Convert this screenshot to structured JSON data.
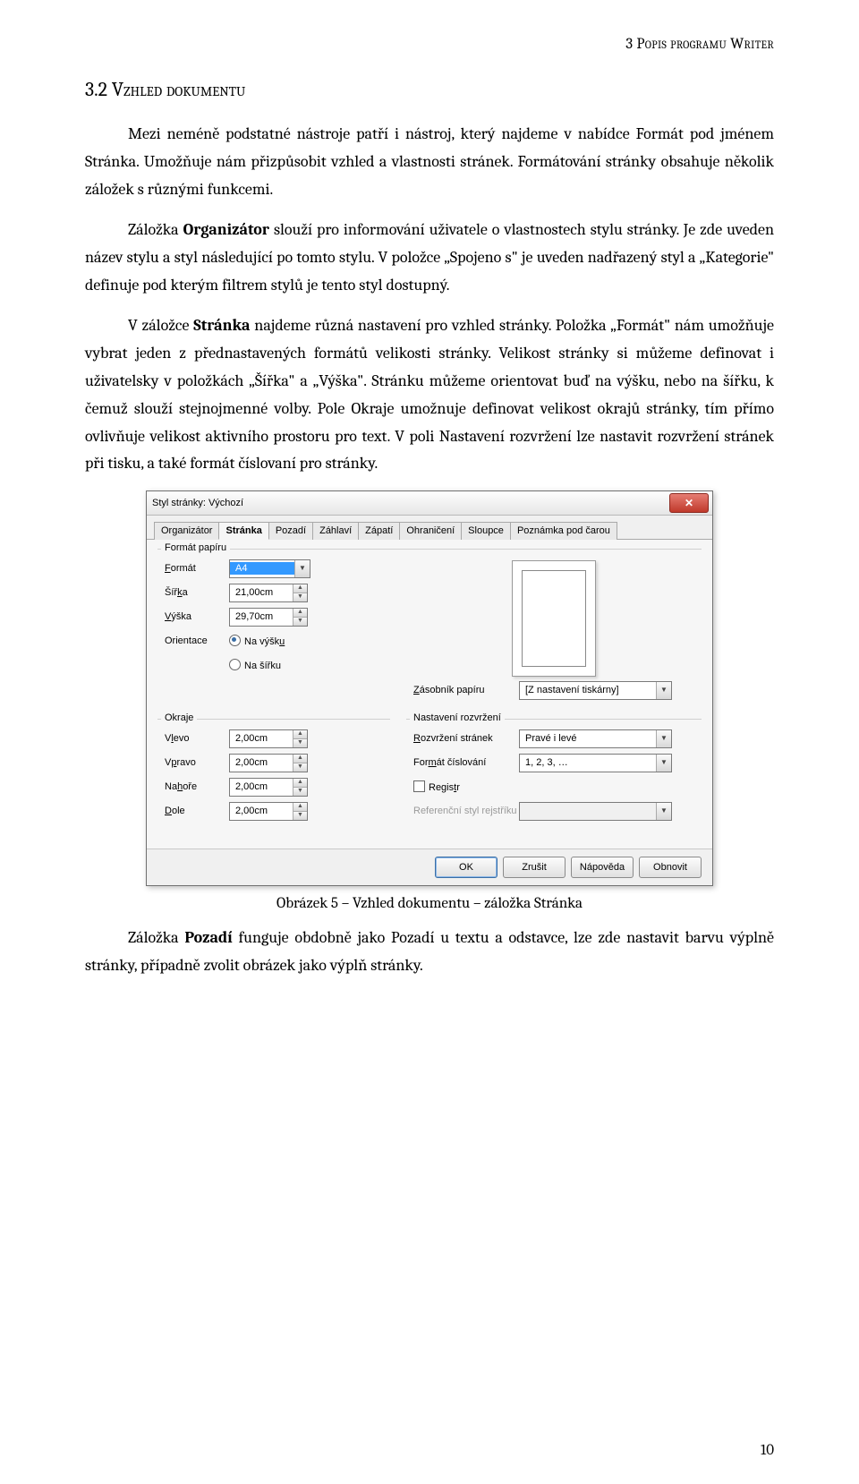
{
  "header": {
    "running": "3 Popis programu Writer"
  },
  "section": {
    "heading": "3.2  Vzhled dokumentu"
  },
  "paragraphs": {
    "p1": "Mezi neméně podstatné nástroje patří i nástroj, který najdeme v nabídce Formát pod jménem Stránka. Umožňuje nám přizpůsobit vzhled a vlastnosti stránek. Formátování stránky obsahuje několik záložek s různými funkcemi.",
    "p2a": "Záložka ",
    "p2b": "Organizátor",
    "p2c": " slouží pro informování uživatele o vlastnostech stylu stránky. Je zde uveden název stylu a styl následující po tomto stylu. V položce „Spojeno s\" je uveden nadřazený styl a „Kategorie\" definuje pod kterým filtrem stylů je tento styl dostupný.",
    "p3a": "V záložce ",
    "p3b": "Stránka",
    "p3c": " najdeme různá nastavení pro vzhled stránky. Položka „Formát\" nám umožňuje vybrat jeden z přednastavených formátů velikosti stránky. Velikost stránky si můžeme definovat i uživatelsky v položkách „Šířka\" a „Výška\". Stránku můžeme orientovat buď na výšku, nebo na šířku, k čemuž slouží stejnojmenné volby. Pole Okraje umožnuje definovat velikost okrajů stránky, tím přímo ovlivňuje velikost aktivního prostoru pro text. V poli Nastavení rozvržení lze nastavit rozvržení stránek při tisku, a také formát číslovaní pro stránky.",
    "p4a": "Záložka ",
    "p4b": "Pozadí",
    "p4c": " funguje obdobně jako Pozadí u textu a odstavce, lze zde nastavit barvu výplně stránky, případně zvolit obrázek jako výplň stránky."
  },
  "figure": {
    "caption": "Obrázek 5 – Vzhled dokumentu – záložka Stránka"
  },
  "page": {
    "number": "10"
  },
  "dialog": {
    "title": "Styl stránky: Výchozí",
    "tabs": [
      "Organizátor",
      "Stránka",
      "Pozadí",
      "Záhlaví",
      "Zápatí",
      "Ohraničení",
      "Sloupce",
      "Poznámka pod čarou"
    ],
    "groups": {
      "paper": "Formát papíru",
      "margins": "Okraje",
      "layout": "Nastavení rozvržení"
    },
    "labels": {
      "format": "Formát",
      "width": "Šířka",
      "height": "Výška",
      "orientation": "Orientace",
      "portrait": "Na výšku",
      "landscape": "Na šířku",
      "tray": "Zásobník papíru",
      "left": "Vlevo",
      "right": "Vpravo",
      "top": "Nahoře",
      "bottom": "Dole",
      "pagelayout": "Rozvržení stránek",
      "numformat": "Formát číslování",
      "register": "Registr",
      "refstyle": "Referenční styl rejstříku"
    },
    "values": {
      "format": "A4",
      "width": "21,00cm",
      "height": "29,70cm",
      "tray": "[Z nastavení tiskárny]",
      "left": "2,00cm",
      "right": "2,00cm",
      "top": "2,00cm",
      "bottom": "2,00cm",
      "pagelayout": "Pravé i levé",
      "numformat": "1, 2, 3, …",
      "refstyle": ""
    },
    "buttons": {
      "ok": "OK",
      "cancel": "Zrušit",
      "help": "Nápověda",
      "reset": "Obnovit"
    }
  }
}
